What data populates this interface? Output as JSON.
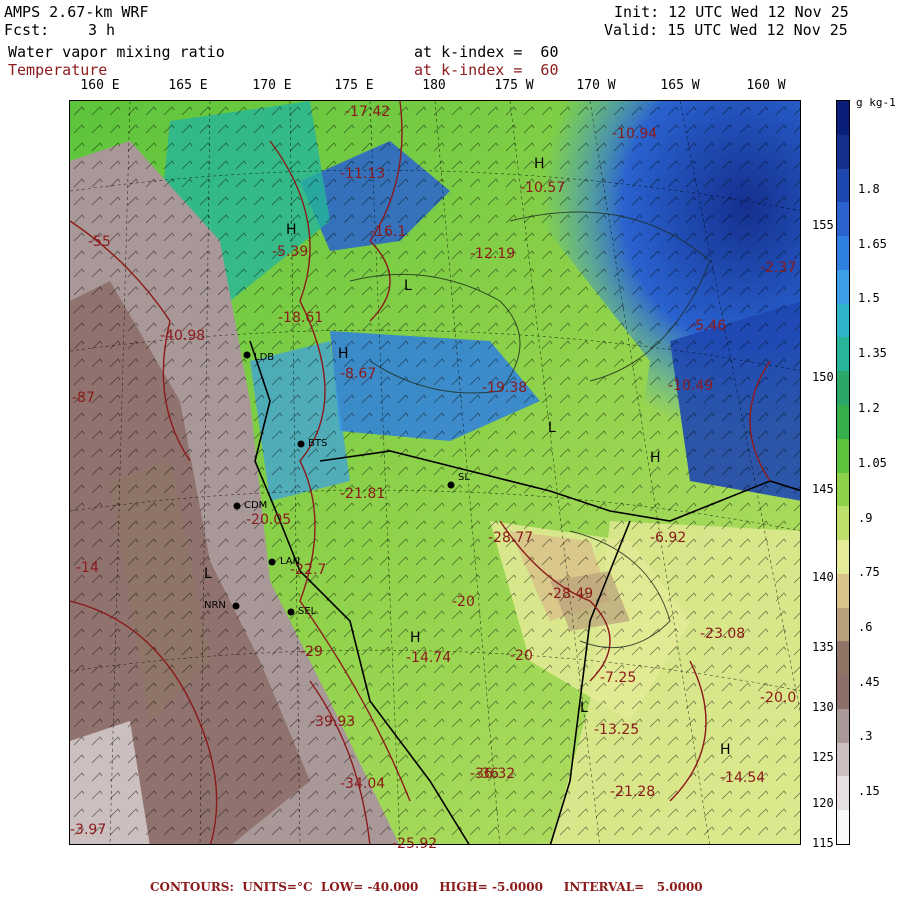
{
  "header": {
    "model": "AMPS 2.67-km WRF",
    "forecast_label": "Fcst:",
    "forecast_value": "3 h",
    "init": "Init: 12 UTC Wed 12 Nov 25",
    "valid": "Valid: 15 UTC Wed 12 Nov 25",
    "field1": "Water vapor mixing ratio",
    "field1_level": "at k-index =  60",
    "field2": "Temperature",
    "field2_level": "at k-index =  60"
  },
  "lon_labels": [
    "160 E",
    "165 E",
    "170 E",
    "175 E",
    "180",
    "175 W",
    "170 W",
    "165 W",
    "160 W"
  ],
  "lat_labels": [
    "155",
    "150",
    "145",
    "140",
    "135",
    "130",
    "125",
    "120",
    "115"
  ],
  "colorbar": {
    "units": "g kg-1",
    "labels": [
      "1.8",
      "1.65",
      "1.5",
      "1.35",
      "1.2",
      "1.05",
      ".9",
      ".75",
      ".6",
      ".45",
      ".3",
      ".15"
    ],
    "colors": [
      "#0a1f7a",
      "#14308f",
      "#1f47b0",
      "#2a62cf",
      "#2f7fe0",
      "#3a9ee8",
      "#2fb3c8",
      "#26b59a",
      "#2aa86a",
      "#36b04a",
      "#5cc43c",
      "#8ed24a",
      "#bde06a",
      "#e4ea96",
      "#d8c48a",
      "#b8a07a",
      "#8e7566",
      "#8d6f6a",
      "#a99898",
      "#cbbfbf",
      "#e6e0e0",
      "#f8f8f8"
    ]
  },
  "footer": "CONTOURS:  UNITS=°C  LOW= -40.000     HIGH= -5.0000     INTERVAL=   5.0000",
  "map": {
    "cities": [
      {
        "name": "BTS"
      },
      {
        "name": "CDM"
      },
      {
        "name": "LAN"
      },
      {
        "name": "NRN"
      },
      {
        "name": "SEL"
      },
      {
        "name": "LDB"
      },
      {
        "name": "SL"
      }
    ],
    "contour_labels": [
      "-17.42",
      "-10.94",
      "-10.57",
      "-11.13",
      "-16.1",
      "-12.19",
      "-18.61",
      "-8.67",
      "-19.38",
      "-10.49",
      "-5.46",
      "-21.81",
      "-28.77",
      "-28.49",
      "-23.08",
      "-20",
      "-14.74",
      "-20",
      "-22.7",
      "-29",
      "-20.05",
      "-39.93",
      "-40.98",
      "-5.39",
      "-3.97",
      "-21.28",
      "-14.54",
      "-20.0",
      "-13.25",
      "-36.32",
      "-25.92",
      "-34.04",
      "-6.92",
      "-7.25",
      "-2.37",
      "-36",
      "-55",
      "-87",
      "-14"
    ],
    "highs_lows": [
      "H",
      "H",
      "L",
      "H",
      "L",
      "H",
      "L",
      "H",
      "L",
      "H"
    ]
  }
}
